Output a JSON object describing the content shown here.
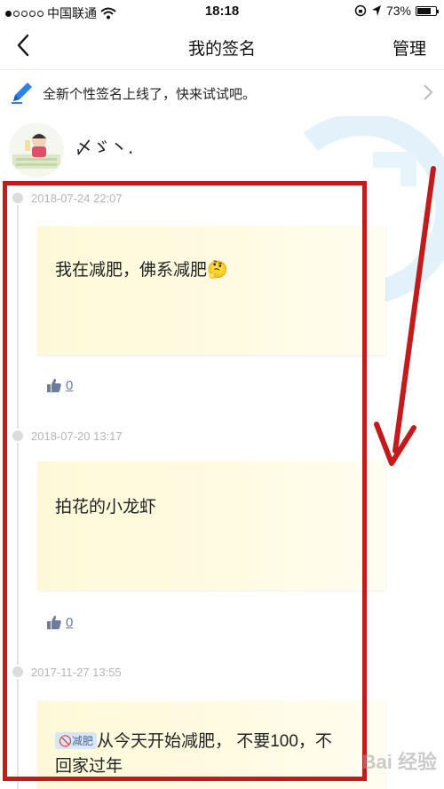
{
  "status_bar": {
    "carrier": "中国联通",
    "time": "18:18",
    "battery": "73%",
    "battery_level": 0.73
  },
  "nav": {
    "title": "我的签名",
    "manage_label": "管理"
  },
  "banner": {
    "text": "全新个性签名上线了，快来试试吧。"
  },
  "profile": {
    "scribble": "〆ゞ丶."
  },
  "entries": [
    {
      "date": "2018-07-24 22:07",
      "text": "我在减肥，佛系减肥🤔",
      "likes": "0"
    },
    {
      "date": "2018-07-20 13:17",
      "text": "拍花的小龙虾",
      "likes": "0"
    },
    {
      "date": "2017-11-27 13:55",
      "tag": "🚫减肥",
      "text_line1": "从今天开始减肥， 不要100，不",
      "text_line2": "回家过年"
    }
  ],
  "watermark": "Bai 经验",
  "colors": {
    "annotation_red": "#c21b1b",
    "card_bg": "#fdf9d8",
    "link_blue": "#6d7c9a",
    "pen_blue": "#2f80ed"
  }
}
